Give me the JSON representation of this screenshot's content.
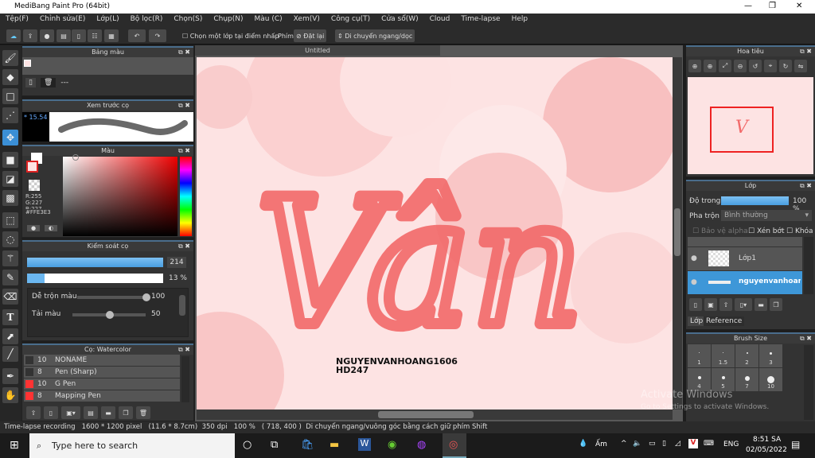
{
  "title": "MediBang Paint Pro (64bit)",
  "menu": [
    "Tệp(F)",
    "Chỉnh sửa(E)",
    "Lớp(L)",
    "Bộ lọc(R)",
    "Chọn(S)",
    "Chụp(N)",
    "Màu (C)",
    "Xem(V)",
    "Công cụ(T)",
    "Cửa sổ(W)",
    "Cloud",
    "Time-lapse",
    "Help"
  ],
  "toolbar": {
    "select_layer_checkbox": "Chọn một lớp tại điểm nhấp",
    "key_label": "Phím",
    "reset": "Đặt lại",
    "move": "Di chuyển ngang/dọc"
  },
  "palette": {
    "title": "Bảng màu",
    "separator": "---"
  },
  "brush_preview": {
    "title": "Xem trước cọ",
    "size": "15.54"
  },
  "color": {
    "title": "Màu",
    "r": "R:255",
    "g": "G:227",
    "b": "B:227",
    "hex": "#FFE3E3",
    "accent": "#ffe3e3"
  },
  "brush_control": {
    "title": "Kiểm soát cọ",
    "size": "214",
    "opacity": "13 %",
    "opacity_value": 13,
    "mix_label": "Dễ trộn màu",
    "mix_value": "100",
    "load_label": "Tải màu",
    "load_value": "50"
  },
  "brushes": {
    "title": "Cọ: Watercolor",
    "items": [
      {
        "size": "10",
        "name": "NONAME"
      },
      {
        "size": "8",
        "name": "Pen (Sharp)"
      },
      {
        "size": "10",
        "name": "G Pen"
      },
      {
        "size": "8",
        "name": "Mapping Pen"
      }
    ]
  },
  "canvas": {
    "tab": "Untitled",
    "main_text": "Vân",
    "signature1": "NGUYENVANHOANG1606",
    "signature2": "HD247"
  },
  "navigator": {
    "title": "Hoa tiêu"
  },
  "layers": {
    "title": "Lớp",
    "opacity_label": "Độ trong",
    "opacity_value": "100 %",
    "blend_label": "Pha trộn",
    "blend_value": "Bình thường",
    "protect_alpha": "Bảo vệ alpha",
    "clip": "Xén bớt",
    "lock": "Khóa",
    "items": [
      "Lớp1",
      "nguyenvanhoang"
    ],
    "tabs": [
      "Lớp",
      "Reference"
    ]
  },
  "brush_size": {
    "title": "Brush Size",
    "sizes": [
      "1",
      "1.5",
      "2",
      "3",
      "4",
      "5",
      "7",
      "10"
    ]
  },
  "status": {
    "recording": "Time-lapse recording",
    "pixels": "1600 * 1200 pixel",
    "cm": "(11.6 * 8.7cm)",
    "dpi": "350 dpi",
    "zoom": "100 %",
    "coords": "( 718, 400 )",
    "hint": "Di chuyển ngang/vuông góc bằng cách giữ phím Shift"
  },
  "watermark": {
    "line1": "Activate Windows",
    "line2": "Go to Settings to activate Windows."
  },
  "taskbar": {
    "search": "Type here to search",
    "weather": "Ấm",
    "lang": "ENG",
    "time": "8:51 SA",
    "date": "02/05/2022"
  }
}
